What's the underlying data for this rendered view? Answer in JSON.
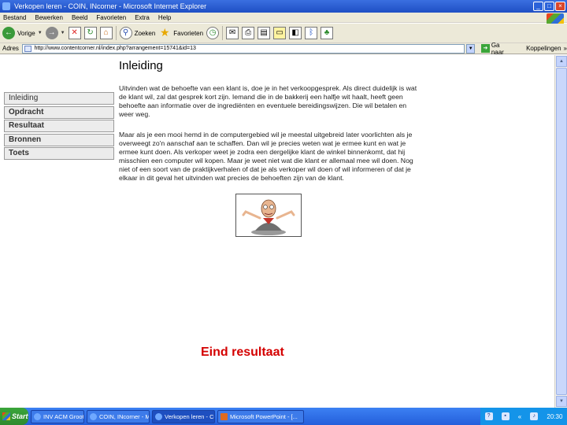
{
  "window": {
    "title": "Verkopen leren - COIN, INcorner - Microsoft Internet Explorer",
    "minimize": "_",
    "maximize": "□",
    "close": "×"
  },
  "menu": [
    "Bestand",
    "Bewerken",
    "Beeld",
    "Favorieten",
    "Extra",
    "Help"
  ],
  "toolbar": {
    "back_label": "Vorige",
    "search_label": "Zoeken",
    "favorites_label": "Favorieten"
  },
  "address": {
    "label": "Adres",
    "url": "http://www.contentcorner.nl/index.php?arrangement=15741&id=13",
    "go_label": "Ga naar",
    "links_label": "Koppelingen"
  },
  "page": {
    "title": "Inleiding",
    "nav": [
      "Inleiding",
      "Opdracht",
      "Resultaat",
      "Bronnen",
      "Toets"
    ],
    "paragraph1": "Uitvinden wat de behoefte van een klant is, doe je in het verkoopgesprek. Als direct duidelijk is wat de klant wil, zal dat gesprek kort zijn. Iemand die in de bakkerij een halfje wit haalt, heeft geen behoefte aan informatie over de ingrediënten en eventuele bereidingswijzen. Die wil betalen en weer weg.",
    "paragraph2": "Maar als je een mooi hemd in de computergebied wil je meestal uitgebreid later voorlichten als je overweegt zo'n aanschaf aan te schaffen. Dan wil je precies weten wat je ermee kunt en wat je ermee kunt doen. Als verkoper weet je zodra een dergelijke klant de winkel binnenkomt, dat hij misschien een computer wil kopen. Maar je weet niet wat die klant er allemaal mee wil doen. Nog niet of een soort van de praktijkverhalen of dat je als verkoper wil doen of wil informeren of dat je elkaar in dit geval het uitvinden wat precies de behoeften zijn van de klant.",
    "end_result": "Eind resultaat"
  },
  "taskbar": {
    "start": "Start",
    "items": [
      "INV ACM Groot - Microsoft",
      "COIN, INcorner - Micros",
      "Verkopen leren - COIN",
      "Microsoft PowerPoint - [..."
    ],
    "clock": "20:30"
  }
}
